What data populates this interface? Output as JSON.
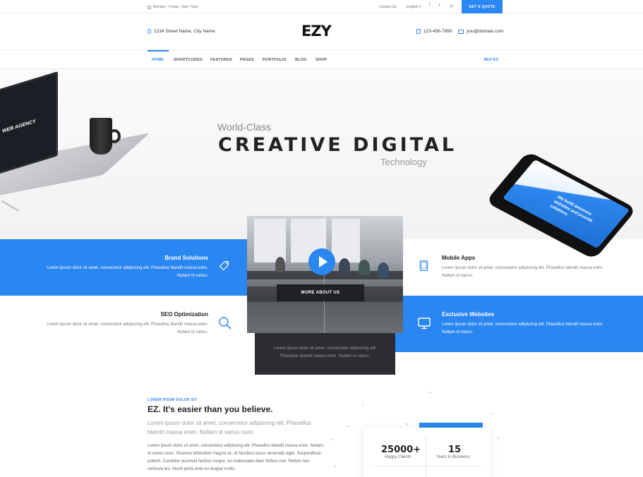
{
  "topbar": {
    "hours": "Monday - Friday : 9am / 6pm",
    "contact": "Contact Us",
    "language": "English ▾",
    "social": [
      "f",
      "t",
      "◎"
    ],
    "quote_button": "GET A QUOTE"
  },
  "header": {
    "address": "1234 Street Name, City Name",
    "logo": "EZY",
    "phone": "123-456-7890",
    "email": "you@domain.com"
  },
  "nav": {
    "items": [
      "HOME",
      "SHORTCODES",
      "FEATURES",
      "PAGES",
      "PORTFOLIO",
      "BLOG",
      "SHOP"
    ],
    "active": "HOME",
    "buy": "BUY EZ"
  },
  "hero": {
    "pre_title": "World-Class",
    "title": "CREATIVE DIGITAL",
    "post_title": "Technology",
    "laptop_screen_text": "WEB AGENCY",
    "phone_screen_text": "We build awesome websites and provide solutions."
  },
  "features": [
    {
      "title": "Brand Solutions",
      "text": "Lorem ipsum dolor sit amet, consectetur adipiscing elit. Phasellus blandit massa enim. Nullam id varius.",
      "icon": "tag-icon"
    },
    {
      "title": "Mobile Apps",
      "text": "Lorem ipsum dolor sit amet, consectetur adipiscing elit. Phasellus blandit massa enim. Nullam id varius.",
      "icon": "tablet-icon"
    },
    {
      "title": "SEO Optimization",
      "text": "Lorem ipsum dolor sit amet, consectetur adipiscing elit. Phasellus blandit massa enim. Nullam id varius.",
      "icon": "search-icon"
    },
    {
      "title": "Exclusive Websites",
      "text": "Lorem ipsum dolor sit amet, consectetur adipiscing elit. Phasellus blandit massa enim. Nullam id varius.",
      "icon": "monitor-icon"
    }
  ],
  "video": {
    "button": "MORE ABOUT US",
    "caption_line1": "Lorem ipsum dolor sit amet, consectetur adipiscing elit.",
    "caption_line2": "Phasellus blandit massa enim. Nullam id varius."
  },
  "about": {
    "kicker": "LOREM IPSUM DOLOR SIT",
    "title": "EZ. It's easier than you believe.",
    "lead": "Lorem ipsum dolor sit amet, consectetur adipiscing elit. Phasellus blandit massa enim. Nullam id varius nunc.",
    "body": "Lorem ipsum dolor sit amet, consectetur adipiscing elit. Phasellus blandit massa enim. Nullam id varius nunc. Vivamus bibendum magna ex, et faucibus lacus venenatis eget. Suspendisse potenti. Curabitur euismod facilisis neque, eu malesuada diam finibus non. Nullam nec vehicula leo. Morbi porta ante eu feugiat mollis."
  },
  "stats": [
    {
      "value": "25000+",
      "label": "Happy Clients"
    },
    {
      "value": "15",
      "label": "Years in Business"
    }
  ],
  "colors": {
    "accent": "#2a86f0",
    "dark": "#2b2d30"
  }
}
